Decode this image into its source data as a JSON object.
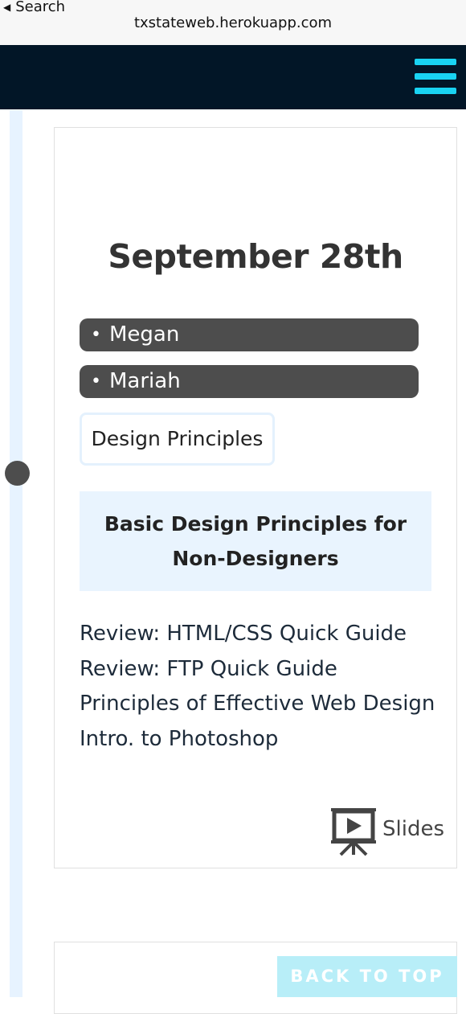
{
  "browser": {
    "back_label": "Search",
    "url": "txstateweb.herokuapp.com"
  },
  "header": {
    "menu_icon": "hamburger-menu-icon",
    "accent_color": "#19d3f2",
    "background_color": "#021627"
  },
  "event": {
    "date": "September 28th",
    "presenters": [
      "Megan",
      "Mariah"
    ],
    "tag": "Design Principles",
    "topic": "Basic Design Principles for Non-Designers",
    "links": [
      "Review: HTML/CSS Quick Guide",
      "Review: FTP Quick Guide",
      "Principles of Effective Web Design",
      "Intro. to Photoshop"
    ],
    "slides_label": "Slides",
    "slides_icon": "presentation-screen-icon"
  },
  "back_to_top_label": "BACK TO TOP"
}
